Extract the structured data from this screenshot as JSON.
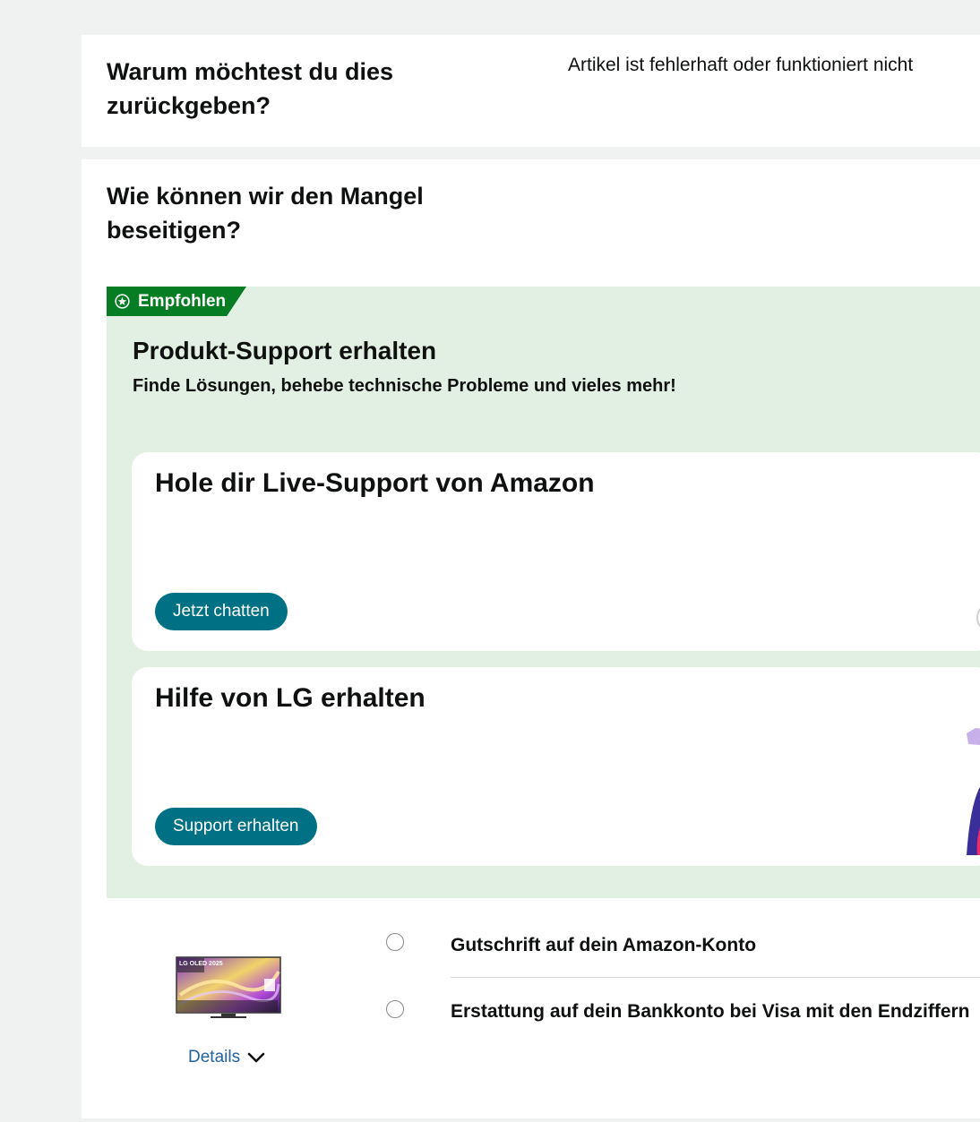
{
  "return_reason": {
    "question": "Warum möchtest du dies zurückgeben?",
    "selected_reason": "Artikel ist fehlerhaft oder funktioniert nicht"
  },
  "fix": {
    "question": "Wie können wir den Mangel beseitigen?",
    "recommended_badge": "Empfohlen",
    "support_title": "Produkt-Support erhalten",
    "support_subtitle": "Finde Lösungen, behebe technische Probleme und vieles mehr!",
    "cards": [
      {
        "title": "Hole dir Live-Support von Amazon",
        "button": "Jetzt chatten"
      },
      {
        "title": "Hilfe von LG erhalten",
        "button": "Support erhalten"
      }
    ]
  },
  "refund_options": [
    {
      "label": "Gutschrift auf dein Amazon-Konto",
      "selected": false
    },
    {
      "label": "Erstattung auf dein Bankkonto bei Visa mit den Endziffern",
      "selected": false
    }
  ],
  "product": {
    "image_label": "LG OLED 2025",
    "details_link": "Details"
  },
  "colors": {
    "recommended_green": "#067d22",
    "panel_green": "#e1f0e2",
    "button_teal": "#007185",
    "link_blue": "#2162a1"
  }
}
